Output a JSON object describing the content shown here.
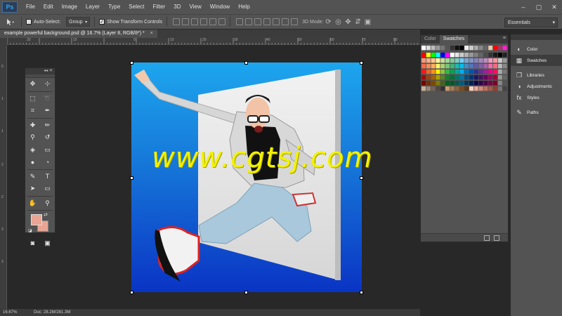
{
  "app": {
    "logo": "Ps"
  },
  "menu": [
    "File",
    "Edit",
    "Image",
    "Layer",
    "Type",
    "Select",
    "Filter",
    "3D",
    "View",
    "Window",
    "Help"
  ],
  "window_controls": [
    "–",
    "▢",
    "✕"
  ],
  "options": {
    "auto_select_label": "Auto-Select:",
    "auto_select_value": "Group",
    "show_transform_label": "Show Transform Controls",
    "mode_3d_label": "3D Mode:",
    "workspace": "Essentials"
  },
  "document": {
    "tab_label": "example powerful background.psd @ 16.7% (Layer 8, RGB/8*) *",
    "close": "×",
    "watermark_text": "www.cgtsj.com"
  },
  "rulers": {
    "top_ticks": [
      "20",
      "10",
      "0",
      "10",
      "20",
      "30",
      "40",
      "50",
      "60",
      "70",
      "80",
      "90"
    ],
    "left_ticks": [
      "0",
      "1",
      "1",
      "2",
      "2",
      "3",
      "3"
    ]
  },
  "tools_panel": {
    "collapse": "◂◂  ✕"
  },
  "swatches_panel": {
    "tabs": [
      "Color",
      "Swatches"
    ],
    "active_tab": "Swatches",
    "menu_icon": "≡"
  },
  "dock": {
    "items": [
      {
        "label": "Color",
        "icon": "◐"
      },
      {
        "label": "Swatches",
        "icon": "▦"
      },
      {
        "label": "Libraries",
        "icon": "❒"
      },
      {
        "label": "Adjustments",
        "icon": "◑"
      },
      {
        "label": "Styles",
        "icon": "fx"
      },
      {
        "label": "Paths",
        "icon": "✎"
      }
    ]
  },
  "status": {
    "zoom": "16.67%",
    "doc_size": "Doc: 28.2M/281.3M"
  },
  "colors": {
    "foreground": "#e8a594",
    "background": "#e8a594"
  }
}
